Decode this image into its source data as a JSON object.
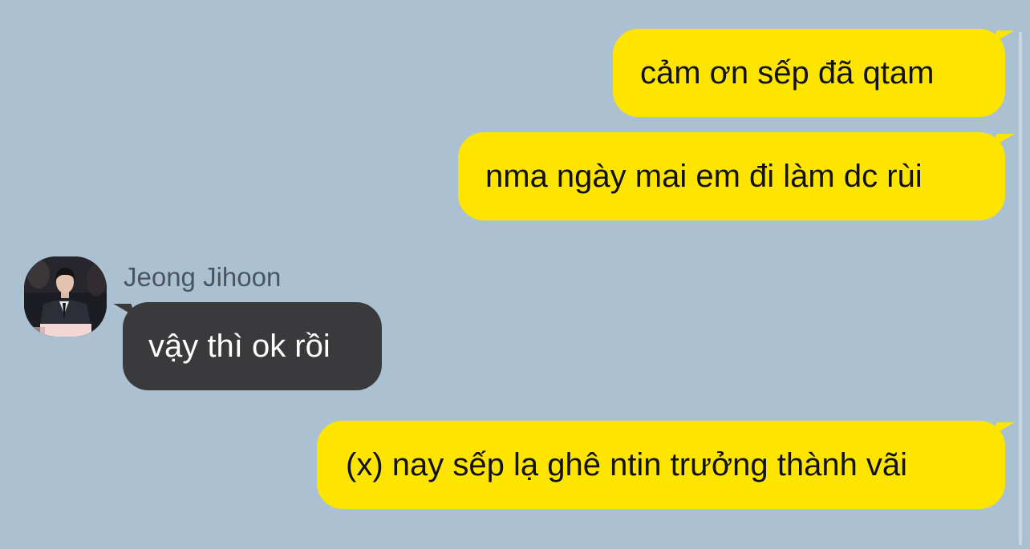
{
  "contact": {
    "name": "Jeong Jihoon"
  },
  "messages": [
    {
      "from": "me",
      "text": "cảm ơn sếp đã qtam"
    },
    {
      "from": "me",
      "text": "nma ngày mai em đi làm dc rùi"
    },
    {
      "from": "them",
      "text": "vậy thì ok rồi"
    },
    {
      "from": "me",
      "text": "(x) nay sếp lạ ghê ntin trưởng thành vãi"
    }
  ],
  "colors": {
    "background": "#abc1d1",
    "my_bubble": "#fee500",
    "their_bubble": "#3a3a3c"
  },
  "icons": {
    "avatar": "profile-photo"
  }
}
